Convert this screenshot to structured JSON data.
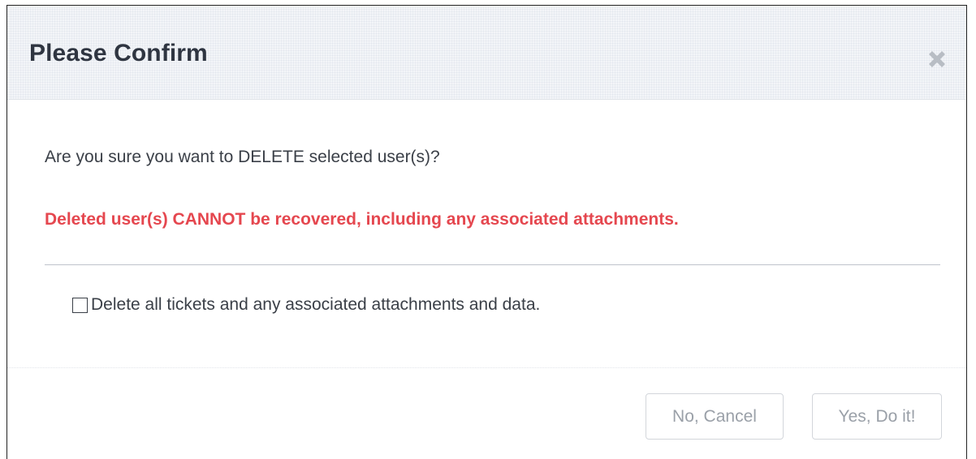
{
  "dialog": {
    "title": "Please Confirm",
    "close_icon": "close-icon",
    "question": "Are you sure you want to DELETE selected user(s)?",
    "warning": "Deleted user(s) CANNOT be recovered, including any associated attachments.",
    "checkbox": {
      "label": "Delete all tickets and any associated attachments and data.",
      "checked": false
    },
    "buttons": {
      "cancel_label": "No, Cancel",
      "confirm_label": "Yes, Do it!"
    }
  },
  "colors": {
    "title": "#2f3541",
    "warning": "#e5474f",
    "disabled_button_text": "#9aa0a8",
    "close_icon": "#b8bdc4"
  }
}
